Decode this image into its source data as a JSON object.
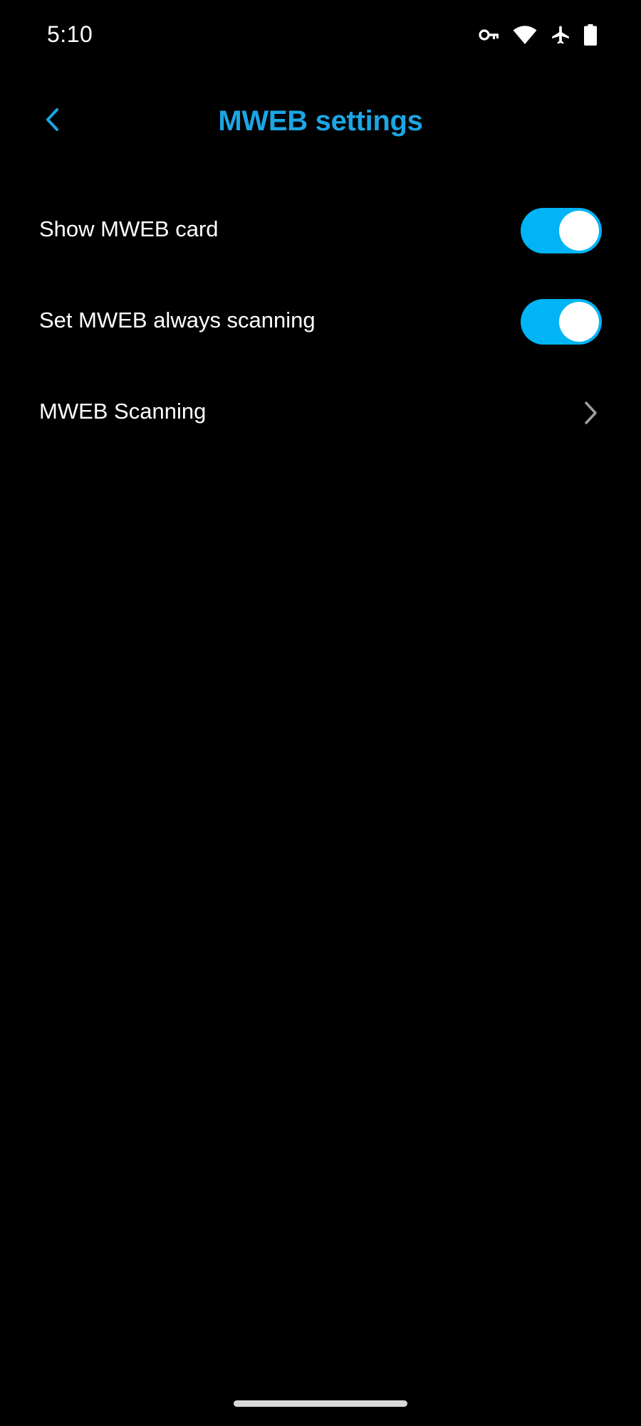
{
  "status_bar": {
    "time": "5:10",
    "icons": [
      "vpn-key-icon",
      "wifi-icon",
      "airplane-mode-icon",
      "battery-icon"
    ]
  },
  "header": {
    "title": "MWEB settings",
    "back_icon": "chevron-left-icon"
  },
  "settings": [
    {
      "label": "Show MWEB card",
      "type": "toggle",
      "enabled": true
    },
    {
      "label": "Set MWEB always scanning",
      "type": "toggle",
      "enabled": true
    },
    {
      "label": "MWEB Scanning",
      "type": "navigation",
      "icon": "chevron-right-icon"
    }
  ],
  "colors": {
    "accent": "#1ba6e4",
    "toggle_on": "#00b4f5",
    "background": "#000000",
    "chevron": "#9e9e9e"
  }
}
